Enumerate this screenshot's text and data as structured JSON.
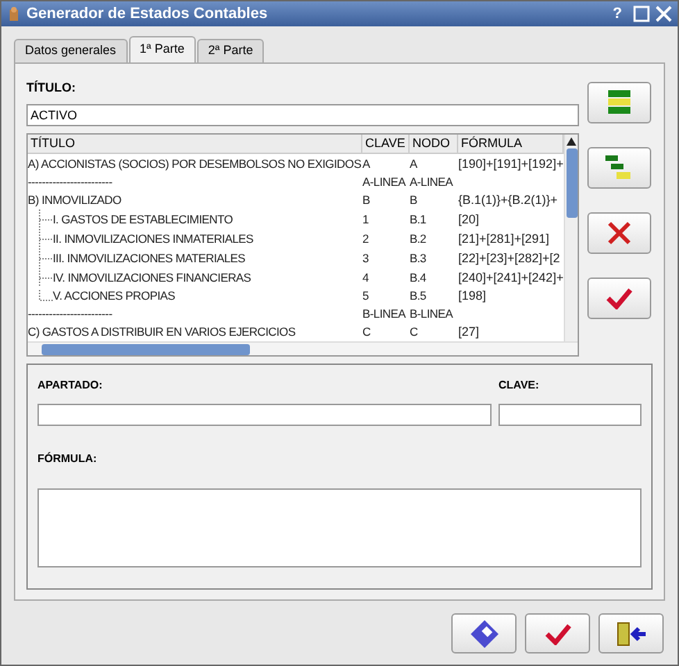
{
  "window": {
    "title": "Generador de Estados Contables",
    "buttons": [
      "?"
    ]
  },
  "tabs": [
    {
      "label": "Datos generales",
      "selected": false
    },
    {
      "label": "1ª Parte",
      "selected": true
    },
    {
      "label": "2ª Parte",
      "selected": false
    }
  ],
  "titulo": {
    "label": "TÍTULO:",
    "value": "ACTIVO"
  },
  "table": {
    "columns": [
      "TÍTULO",
      "CLAVE",
      "NODO",
      "FÓRMULA"
    ],
    "rows": [
      {
        "titulo": "A) ACCIONISTAS (SOCIOS) POR DESEMBOLSOS NO EXIGIDOS",
        "clave": "A",
        "nodo": "A",
        "formula": "[190]+[191]+[192]+"
      },
      {
        "titulo": "------------------------",
        "clave": "A-LINEA",
        "nodo": "A-LINEA",
        "formula": ""
      },
      {
        "titulo": "B) INMOVILIZADO",
        "clave": "B",
        "nodo": "B",
        "formula": "{B.1(1)}+{B.2(1)}+",
        "children": [
          {
            "titulo": "I. GASTOS DE ESTABLECIMIENTO",
            "clave": "1",
            "nodo": "B.1",
            "formula": "[20]"
          },
          {
            "titulo": "II. INMOVILIZACIONES INMATERIALES",
            "clave": "2",
            "nodo": "B.2",
            "formula": "[21]+[281]+[291]"
          },
          {
            "titulo": "III. INMOVILIZACIONES MATERIALES",
            "clave": "3",
            "nodo": "B.3",
            "formula": "[22]+[23]+[282]+[2"
          },
          {
            "titulo": "IV. INMOVILIZACIONES FINANCIERAS",
            "clave": "4",
            "nodo": "B.4",
            "formula": "[240]+[241]+[242]+"
          },
          {
            "titulo": "V. ACCIONES PROPIAS",
            "clave": "5",
            "nodo": "B.5",
            "formula": "[198]"
          }
        ]
      },
      {
        "titulo": "------------------------",
        "clave": "B-LINEA",
        "nodo": "B-LINEA",
        "formula": ""
      },
      {
        "titulo": "C) GASTOS A DISTRIBUIR EN VARIOS EJERCICIOS",
        "clave": "C",
        "nodo": "C",
        "formula": "[27]"
      }
    ]
  },
  "form": {
    "apartado_label": "APARTADO:",
    "clave_label": "CLAVE:",
    "formula_label": "FÓRMULA:"
  }
}
